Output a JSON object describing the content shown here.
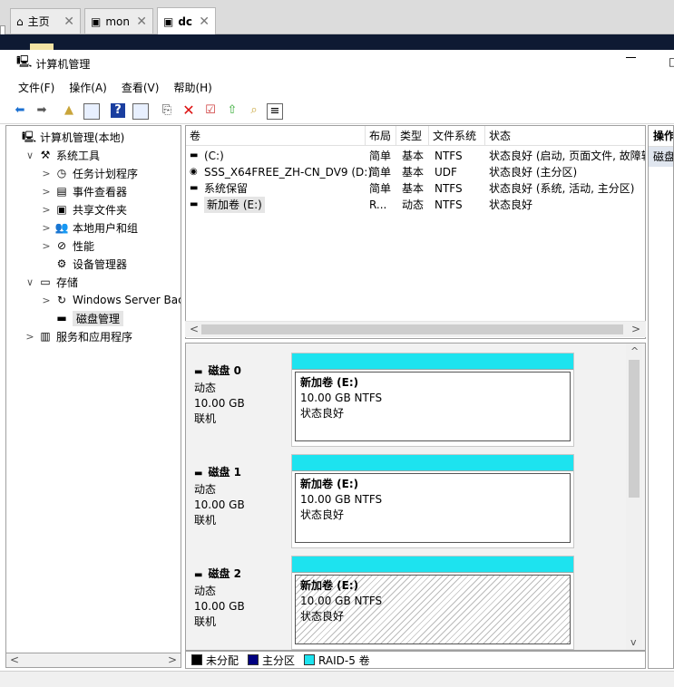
{
  "browser_tabs": [
    {
      "label": "主页",
      "icon": "home-icon",
      "active": false
    },
    {
      "label": "mon",
      "icon": "vm-icon",
      "active": false
    },
    {
      "label": "dc",
      "icon": "vm-icon",
      "active": true
    }
  ],
  "window": {
    "title": "计算机管理",
    "restore": "□"
  },
  "menu": [
    "文件(F)",
    "操作(A)",
    "查看(V)",
    "帮助(H)"
  ],
  "toolbar_icons": [
    "back-arrow-icon",
    "forward-arrow-icon",
    "up-folder-icon",
    "show-tree-icon",
    "help-icon",
    "properties-icon",
    "connect-icon",
    "delete-icon",
    "check-icon",
    "import-icon",
    "search-icon",
    "list-icon"
  ],
  "tree": [
    {
      "label": "计算机管理(本地)",
      "level": 0,
      "chev": "",
      "icon": "computer-mgmt-icon"
    },
    {
      "label": "系统工具",
      "level": 1,
      "chev": "∨",
      "icon": "tools-icon"
    },
    {
      "label": "任务计划程序",
      "level": 2,
      "chev": ">",
      "icon": "clock-icon"
    },
    {
      "label": "事件查看器",
      "level": 2,
      "chev": ">",
      "icon": "event-viewer-icon"
    },
    {
      "label": "共享文件夹",
      "level": 2,
      "chev": ">",
      "icon": "shared-folder-icon"
    },
    {
      "label": "本地用户和组",
      "level": 2,
      "chev": ">",
      "icon": "users-icon"
    },
    {
      "label": "性能",
      "level": 2,
      "chev": ">",
      "icon": "performance-icon"
    },
    {
      "label": "设备管理器",
      "level": 2,
      "chev": "",
      "icon": "device-manager-icon"
    },
    {
      "label": "存储",
      "level": 1,
      "chev": "∨",
      "icon": "storage-icon"
    },
    {
      "label": "Windows Server Back",
      "level": 2,
      "chev": ">",
      "icon": "backup-icon"
    },
    {
      "label": "磁盘管理",
      "level": 2,
      "chev": "",
      "icon": "disk-mgmt-icon",
      "selected": true
    },
    {
      "label": "服务和应用程序",
      "level": 1,
      "chev": ">",
      "icon": "services-icon"
    }
  ],
  "volume_columns": [
    "卷",
    "布局",
    "类型",
    "文件系统",
    "状态"
  ],
  "volumes": [
    {
      "name": "(C:)",
      "layout": "简单",
      "type": "基本",
      "fs": "NTFS",
      "status": "状态良好 (启动, 页面文件, 故障转",
      "icon": "drive-icon"
    },
    {
      "name": "SSS_X64FREE_ZH-CN_DV9 (D:)",
      "layout": "简单",
      "type": "基本",
      "fs": "UDF",
      "status": "状态良好 (主分区)",
      "icon": "cd-icon"
    },
    {
      "name": "系统保留",
      "layout": "简单",
      "type": "基本",
      "fs": "NTFS",
      "status": "状态良好 (系统, 活动, 主分区)",
      "icon": "drive-icon"
    },
    {
      "name": "新加卷 (E:)",
      "layout": "R...",
      "type": "动态",
      "fs": "NTFS",
      "status": "状态良好",
      "icon": "drive-icon"
    }
  ],
  "disks": [
    {
      "name": "磁盘 0",
      "kind": "动态",
      "size": "10.00 GB",
      "state": "联机",
      "part_name": "新加卷 (E:)",
      "part_size": "10.00 GB NTFS",
      "part_status": "状态良好",
      "hatched": false
    },
    {
      "name": "磁盘 1",
      "kind": "动态",
      "size": "10.00 GB",
      "state": "联机",
      "part_name": "新加卷 (E:)",
      "part_size": "10.00 GB NTFS",
      "part_status": "状态良好",
      "hatched": false
    },
    {
      "name": "磁盘 2",
      "kind": "动态",
      "size": "10.00 GB",
      "state": "联机",
      "part_name": "新加卷 (E:)",
      "part_size": "10.00 GB NTFS",
      "part_status": "状态良好",
      "hatched": true
    }
  ],
  "legend": [
    {
      "label": "未分配",
      "color": "#000000"
    },
    {
      "label": "主分区",
      "color": "#000080"
    },
    {
      "label": "RAID-5 卷",
      "color": "#1de3ef"
    }
  ],
  "actions": {
    "header": "操作",
    "item": "磁盘"
  },
  "colors": {
    "raid_strip": "#1de3ef",
    "nav_band": "#0e1a33"
  }
}
